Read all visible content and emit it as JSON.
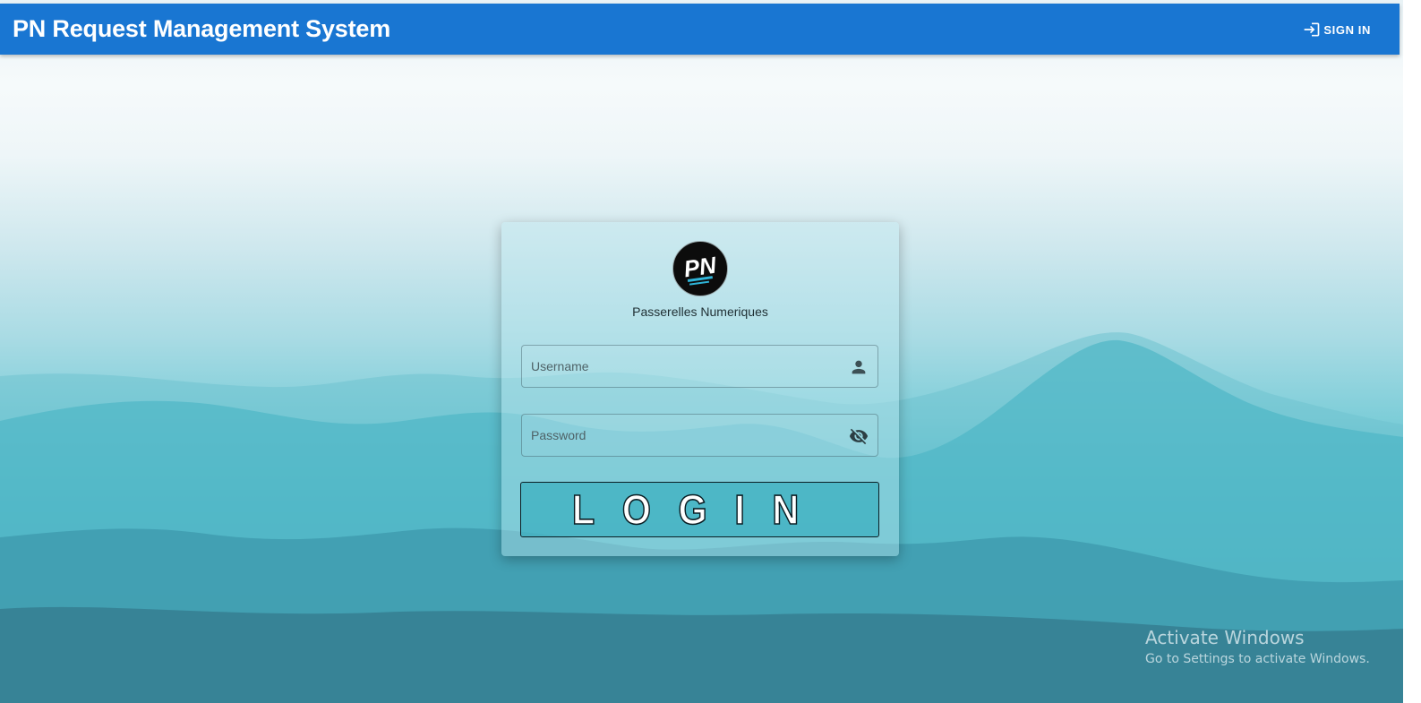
{
  "header": {
    "title": "PN Request Management System",
    "sign_in_label": "SIGN IN",
    "sign_in_icon": "login-icon",
    "color": "#1976d2"
  },
  "login_card": {
    "logo_text": "PN",
    "org_name": "Passerelles Numeriques",
    "username": {
      "placeholder": "Username",
      "value": "",
      "icon": "person-icon"
    },
    "password": {
      "placeholder": "Password",
      "value": "",
      "icon": "visibility-off-icon"
    },
    "login_label": "LOGIN"
  },
  "watermark": {
    "title": "Activate Windows",
    "subtitle": "Go to Settings to activate Windows."
  }
}
